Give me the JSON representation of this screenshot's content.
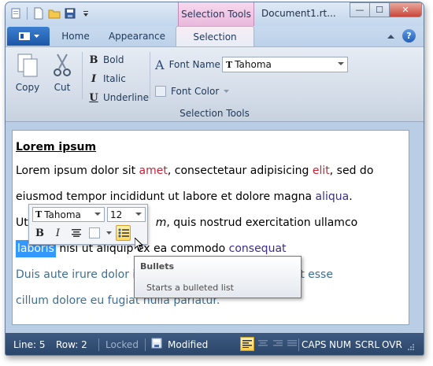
{
  "titlebar": {
    "context_tab": "Selection Tools",
    "document_title": "Document1.rt..."
  },
  "tabs": {
    "home": "Home",
    "appearance": "Appearance",
    "selection": "Selection"
  },
  "ribbon": {
    "copy": "Copy",
    "cut": "Cut",
    "bold": "Bold",
    "italic": "Italic",
    "underline": "Underline",
    "font_name_label": "Font Name",
    "font_name_value": "Tahoma",
    "font_color_label": "Font Color",
    "group_label": "Selection Tools"
  },
  "document": {
    "heading": "Lorem ipsum",
    "line1_a": "Lorem ipsum dolor sit ",
    "line1_b": "amet",
    "line1_c": ", consectetaur adipisicing ",
    "line1_d": "elit",
    "line1_e": ", sed do",
    "line2_a": "eiusmod tempor incididunt ut labore et dolore magna ",
    "line2_b": "aliqua",
    "line2_c": ".",
    "line3_a": "Ut",
    "line3_b": "m",
    "line3_c": ", quis nostrud exercitation ullamco",
    "line4_sel": "laboris",
    "line4_a": " nisi ut aliquip ex ea commodo ",
    "line4_b": "consequat",
    "line5_a": "Duis aute irure dolor in",
    "line5_b": "t esse",
    "line6": " cillum dolore eu fugiat nulla pariatur."
  },
  "mini_toolbar": {
    "font": "Tahoma",
    "size": "12"
  },
  "tooltip": {
    "title": "Bullets",
    "description": "Starts a bulleted list"
  },
  "statusbar": {
    "line_label": "Line:",
    "line_value": "5",
    "row_label": "Row:",
    "row_value": "2",
    "locked": "Locked",
    "modified": "Modified",
    "caps": "CAPS",
    "num": "NUM",
    "scrl": "SCRL",
    "ovr": "OVR"
  },
  "colors": {
    "accent": "#1c57a7",
    "context_tab": "#e9b8dc",
    "statusbar": "#294469",
    "selection": "#3399ff"
  }
}
